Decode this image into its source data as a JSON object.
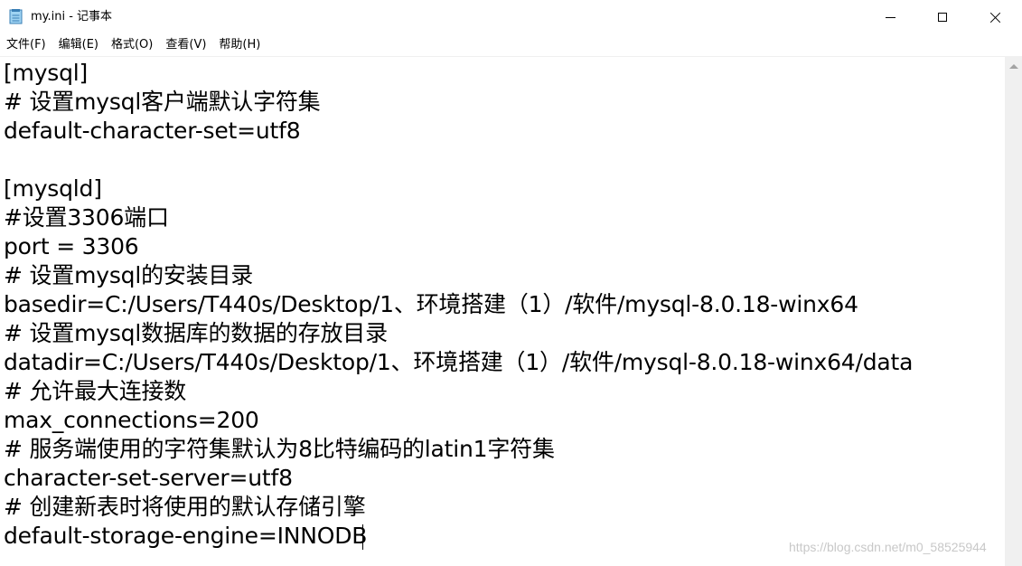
{
  "window": {
    "title": "my.ini - 记事本",
    "icon": "notepad-icon"
  },
  "menu": [
    {
      "label": "文件(F)"
    },
    {
      "label": "编辑(E)"
    },
    {
      "label": "格式(O)"
    },
    {
      "label": "查看(V)"
    },
    {
      "label": "帮助(H)"
    }
  ],
  "editor": {
    "lines": [
      "[mysql]",
      "# 设置mysql客户端默认字符集",
      "default-character-set=utf8",
      "",
      "[mysqld]",
      "#设置3306端口",
      "port = 3306",
      "# 设置mysql的安装目录",
      "basedir=C:/Users/T440s/Desktop/1、环境搭建（1）/软件/mysql-8.0.18-winx64",
      "# 设置mysql数据库的数据的存放目录",
      "datadir=C:/Users/T440s/Desktop/1、环境搭建（1）/软件/mysql-8.0.18-winx64/data",
      "# 允许最大连接数",
      "max_connections=200",
      "# 服务端使用的字符集默认为8比特编码的latin1字符集",
      "character-set-server=utf8",
      "# 创建新表时将使用的默认存储引擎",
      "default-storage-engine=INNODB"
    ]
  },
  "watermark": "https://blog.csdn.net/m0_58525944"
}
